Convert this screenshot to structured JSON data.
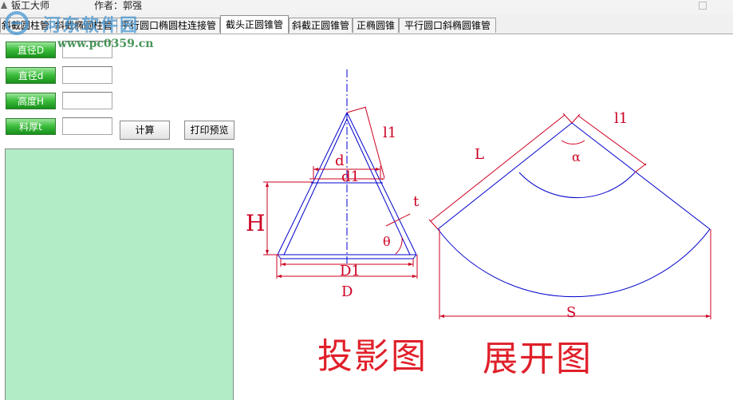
{
  "window": {
    "title": "钣工大师",
    "author": "作者：郭强"
  },
  "tabs": [
    "斜截圆柱管",
    "斜截椭圆柱管",
    "平行圆口椭圆柱连接管",
    "截头正圆锥管",
    "斜截正圆锥管",
    "正椭圆锥",
    "平行圆口斜椭圆锥管"
  ],
  "active_tab": "截头正圆锥管",
  "watermark": {
    "text": "河东软件园",
    "url": "www.pc0359.cn"
  },
  "params": [
    {
      "label": "直径D",
      "value": ""
    },
    {
      "label": "直径d",
      "value": ""
    },
    {
      "label": "高度H",
      "value": ""
    },
    {
      "label": "料厚t",
      "value": ""
    }
  ],
  "buttons": {
    "calc": "计算",
    "print_preview": "打印预览"
  },
  "diagram": {
    "labels": {
      "l1": "l1",
      "d": "d",
      "d1": "d1",
      "t": "t",
      "H": "H",
      "theta": "θ",
      "D1": "D1",
      "D": "D",
      "L": "L",
      "alpha": "α",
      "l1_dev": "l1",
      "S": "S"
    },
    "captions": {
      "projection": "投影图",
      "development": "展开图"
    },
    "colors": {
      "outline": "#0000cc",
      "dimension": "#cc0022",
      "axis": "#0000cc"
    }
  }
}
